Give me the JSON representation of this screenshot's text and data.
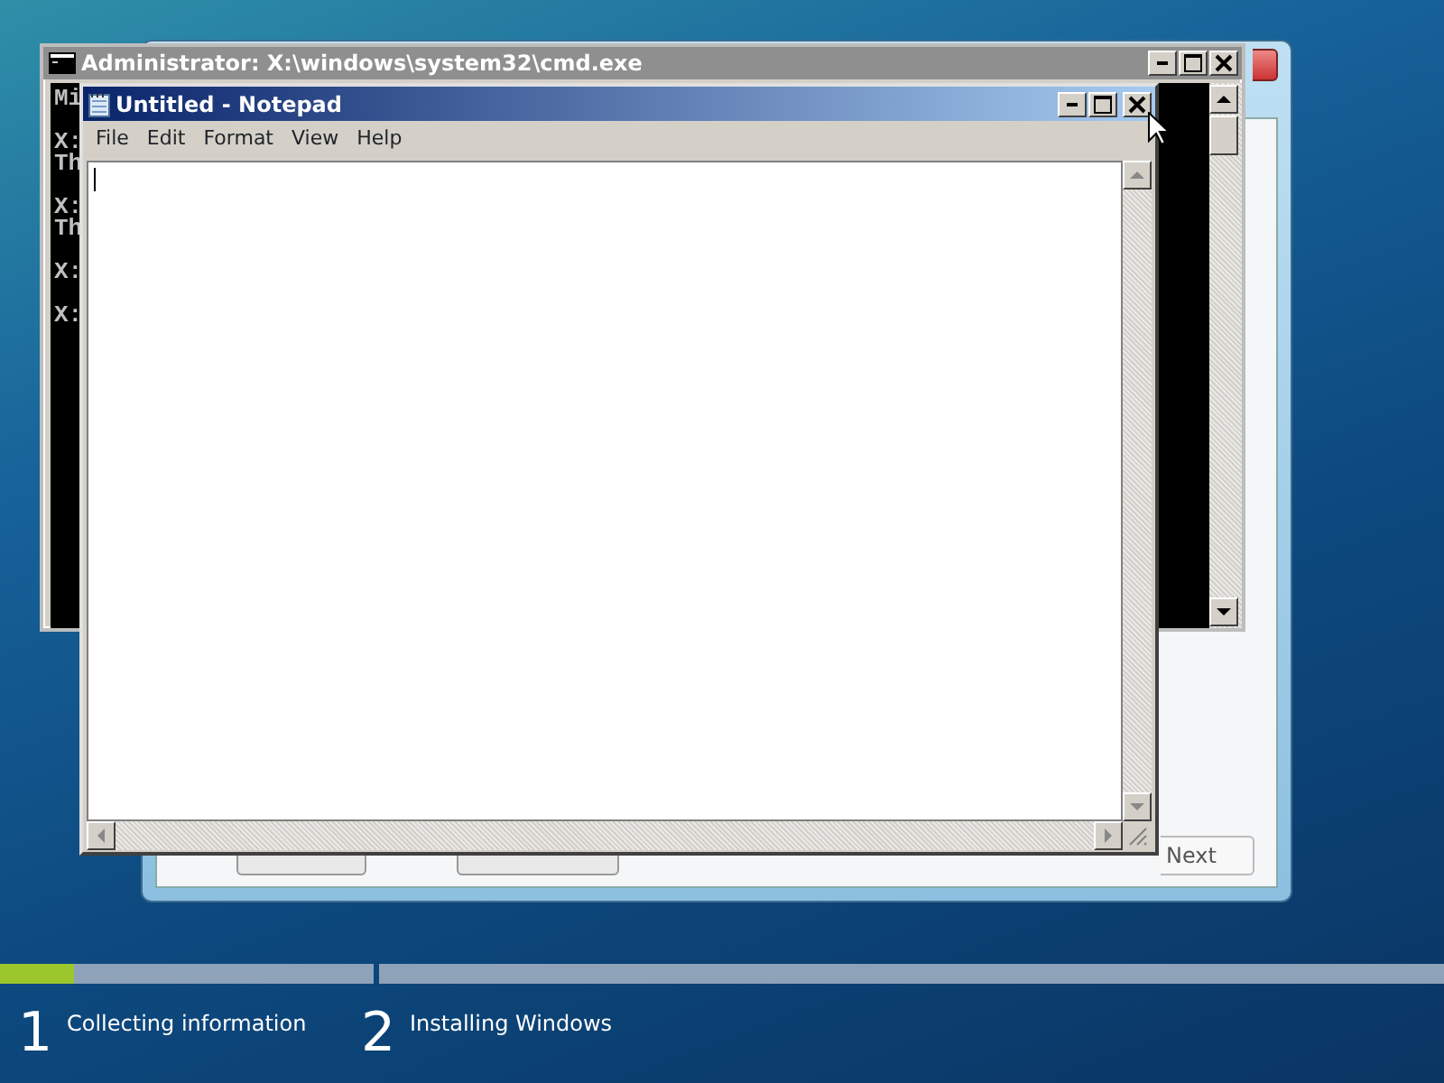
{
  "setup_dialog": {
    "buttons": [
      {
        "label": "Next"
      }
    ]
  },
  "cmd_window": {
    "title": "Administrator: X:\\windows\\system32\\cmd.exe",
    "blocks": [
      [
        "Mi"
      ],
      [
        "X:",
        "Th"
      ],
      [
        "X:",
        "Th"
      ],
      [
        "X:"
      ],
      [
        "X:"
      ]
    ]
  },
  "notepad": {
    "title": "Untitled - Notepad",
    "menu": [
      "File",
      "Edit",
      "Format",
      "View",
      "Help"
    ]
  },
  "setup_progress": {
    "steps": [
      {
        "number": "1",
        "label": "Collecting information",
        "level": 0.2
      },
      {
        "number": "2",
        "label": "Installing Windows"
      }
    ]
  }
}
